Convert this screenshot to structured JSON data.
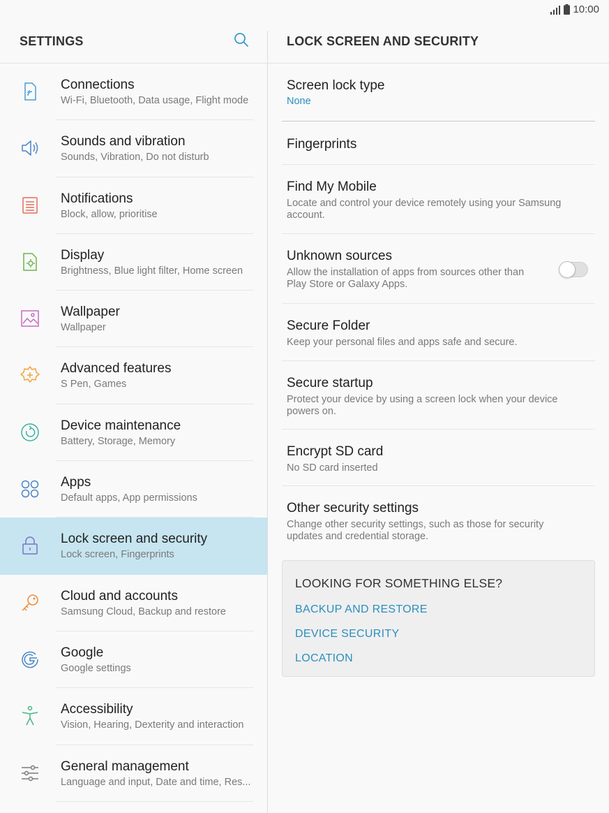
{
  "status_bar": {
    "time": "10:00",
    "icons": [
      "signal-icon",
      "battery-icon"
    ]
  },
  "left_header": {
    "title": "SETTINGS",
    "search_icon": "search-icon"
  },
  "right_header": {
    "title": "LOCK SCREEN AND SECURITY"
  },
  "menu": [
    {
      "title": "Connections",
      "sub": "Wi-Fi, Bluetooth, Data usage, Flight mode",
      "icon": "connections-icon",
      "color": "#4a9ed1"
    },
    {
      "title": "Sounds and vibration",
      "sub": "Sounds, Vibration, Do not disturb",
      "icon": "speaker-icon",
      "color": "#4a86c8"
    },
    {
      "title": "Notifications",
      "sub": "Block, allow, prioritise",
      "icon": "notifications-icon",
      "color": "#e66d5c"
    },
    {
      "title": "Display",
      "sub": "Brightness, Blue light filter, Home screen",
      "icon": "display-icon",
      "color": "#6db54a"
    },
    {
      "title": "Wallpaper",
      "sub": "Wallpaper",
      "icon": "wallpaper-icon",
      "color": "#c56bc0"
    },
    {
      "title": "Advanced features",
      "sub": "S Pen, Games",
      "icon": "advanced-features-icon",
      "color": "#f0a63c"
    },
    {
      "title": "Device maintenance",
      "sub": "Battery, Storage, Memory",
      "icon": "device-maintenance-icon",
      "color": "#3bb3a0"
    },
    {
      "title": "Apps",
      "sub": "Default apps, App permissions",
      "icon": "apps-icon",
      "color": "#4a86c8"
    },
    {
      "title": "Lock screen and security",
      "sub": "Lock screen, Fingerprints",
      "icon": "lock-icon",
      "color": "#7a73c8",
      "active": true
    },
    {
      "title": "Cloud and accounts",
      "sub": "Samsung Cloud, Backup and restore",
      "icon": "key-icon",
      "color": "#f08a3c"
    },
    {
      "title": "Google",
      "sub": "Google settings",
      "icon": "google-icon",
      "color": "#4a86c8"
    },
    {
      "title": "Accessibility",
      "sub": "Vision, Hearing, Dexterity and interaction",
      "icon": "accessibility-icon",
      "color": "#4ab58a"
    },
    {
      "title": "General management",
      "sub": "Language and input, Date and time, Res...",
      "icon": "sliders-icon",
      "color": "#7a7a7a"
    }
  ],
  "right_items": [
    {
      "title": "Screen lock type",
      "sub": "None",
      "accent": true
    },
    {
      "title": "Fingerprints",
      "sub": ""
    },
    {
      "title": "Find My Mobile",
      "sub": "Locate and control your device remotely using your Samsung account."
    },
    {
      "title": "Unknown sources",
      "sub": "Allow the installation of apps from sources other than Play Store or Galaxy Apps.",
      "toggle": false
    },
    {
      "title": "Secure Folder",
      "sub": "Keep your personal files and apps safe and secure."
    },
    {
      "title": "Secure startup",
      "sub": "Protect your device by using a screen lock when your device powers on."
    },
    {
      "title": "Encrypt SD card",
      "sub": "No SD card inserted"
    },
    {
      "title": "Other security settings",
      "sub": "Change other security settings, such as those for security updates and credential storage."
    }
  ],
  "looking": {
    "title": "LOOKING FOR SOMETHING ELSE?",
    "links": [
      "BACKUP AND RESTORE",
      "DEVICE SECURITY",
      "LOCATION"
    ]
  },
  "colors": {
    "accent": "#2a8fbf",
    "active_bg": "#c6e5f0"
  }
}
